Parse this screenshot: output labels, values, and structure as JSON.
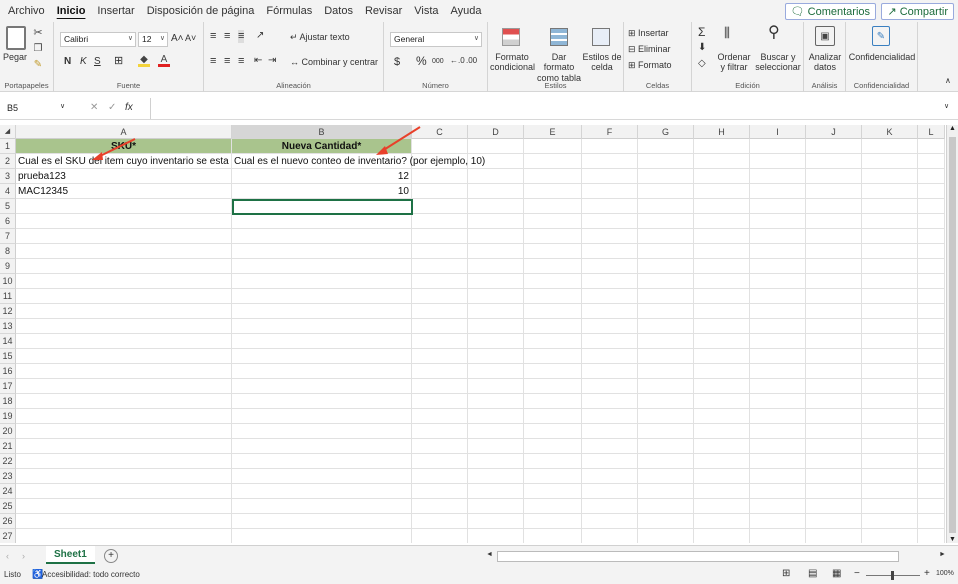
{
  "menu": {
    "tabs": [
      "Archivo",
      "Inicio",
      "Insertar",
      "Disposición de página",
      "Fórmulas",
      "Datos",
      "Revisar",
      "Vista",
      "Ayuda"
    ],
    "active_tab": "Inicio",
    "comments_label": "Comentarios",
    "share_label": "Compartir"
  },
  "ribbon": {
    "clipboard": {
      "paste": "Pegar",
      "label": "Portapapeles"
    },
    "font": {
      "name": "Calibri",
      "size": "12",
      "label": "Fuente",
      "bold": "N",
      "italic": "K",
      "underline": "S"
    },
    "alignment": {
      "wrap": "Ajustar texto",
      "merge": "Combinar y centrar",
      "label": "Alineación"
    },
    "number": {
      "format": "General",
      "label": "Número",
      "currency": "$",
      "percent": "%",
      "thousands": "000"
    },
    "styles": {
      "conditional": "Formato condicional",
      "table": "Dar formato como tabla",
      "cell": "Estilos de celda",
      "label": "Estilos"
    },
    "cells": {
      "insert": "Insertar",
      "delete": "Eliminar",
      "format": "Formato",
      "label": "Celdas"
    },
    "editing": {
      "sort": "Ordenar y filtrar",
      "find": "Buscar y seleccionar",
      "label": "Edición"
    },
    "analysis": {
      "analyze": "Analizar datos",
      "label": "Análisis"
    },
    "sensitivity": {
      "conf": "Confidencialidad",
      "label": "Confidencialidad"
    }
  },
  "formula_bar": {
    "name_box": "B5",
    "fx": "fx",
    "content": ""
  },
  "columns": [
    "A",
    "B",
    "C",
    "D",
    "E",
    "F",
    "G",
    "H",
    "I",
    "J",
    "K",
    "L"
  ],
  "rows": [
    "1",
    "2",
    "3",
    "4",
    "5",
    "6",
    "7",
    "8",
    "9",
    "10",
    "11",
    "12",
    "13",
    "14",
    "15",
    "16",
    "17",
    "18",
    "19",
    "20",
    "21",
    "22",
    "23",
    "24",
    "25",
    "26",
    "27"
  ],
  "cells": {
    "A1": "SKU*",
    "B1": "Nueva Cantidad*",
    "A2": "Cual es el SKU del item cuyo inventario se esta actu",
    "B2": "Cual es el nuevo conteo de inventario? (por ejemplo, 10)",
    "A3": "prueba123",
    "B3": "12",
    "A4": "MAC12345",
    "B4": "10"
  },
  "sheet_tabs": [
    "Sheet1"
  ],
  "status": {
    "ready": "Listo",
    "accessibility": "Accesibilidad: todo correcto",
    "zoom": "100%"
  }
}
